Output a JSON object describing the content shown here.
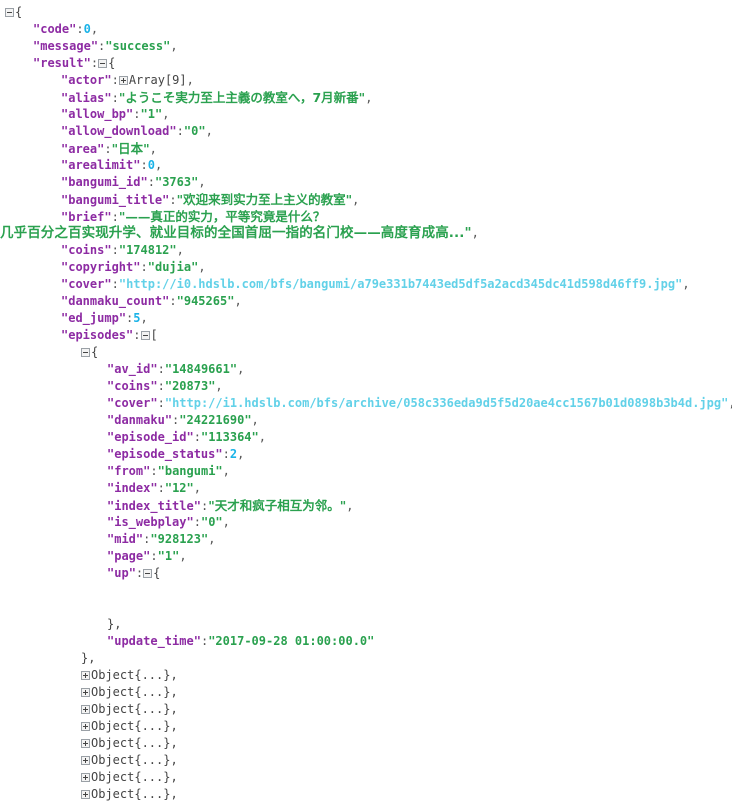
{
  "viewer": {
    "name": "json-tree-viewer",
    "colors": {
      "key": "#8d2ba3",
      "string": "#2aa14f",
      "number": "#1ab3e8",
      "url": "#62d1e8",
      "punctuation": "#555555",
      "background": "#ffffff"
    },
    "icons": {
      "collapse": "minus-box-icon",
      "expand": "plus-box-icon"
    }
  },
  "punct": {
    "colon": ":",
    "comma": ",",
    "quote": "\"",
    "open_brace": "{",
    "close_brace": "}",
    "close_brace_comma": "},",
    "open_bracket": "[",
    "close_bracket": "]"
  },
  "labels": {
    "array_9": "Array[9]",
    "object_collapsed": "Object{...},"
  },
  "root": {
    "keys": {
      "code": "code",
      "message": "message",
      "result": "result"
    },
    "values": {
      "code": "0",
      "message": "success"
    }
  },
  "result": {
    "keys": {
      "actor": "actor",
      "alias": "alias",
      "allow_bp": "allow_bp",
      "allow_download": "allow_download",
      "area": "area",
      "arealimit": "arealimit",
      "bangumi_id": "bangumi_id",
      "bangumi_title": "bangumi_title",
      "brief": "brief",
      "coins": "coins",
      "copyright": "copyright",
      "cover": "cover",
      "danmaku_count": "danmaku_count",
      "ed_jump": "ed_jump",
      "episodes": "episodes"
    },
    "values": {
      "actor": "Array[9]",
      "alias": "ようこそ実力至上主義の教室へ，7月新番",
      "allow_bp": "1",
      "allow_download": "0",
      "area": "日本",
      "arealimit": "0",
      "bangumi_id": "3763",
      "bangumi_title": "欢迎来到实力至上主义的教室",
      "brief_line1": "——真正的实力，平等究竟是什么？",
      "brief_line2": "几乎百分之百实现升学、就业目标的全国首屈一指的名门校——高度育成高...",
      "coins": "174812",
      "copyright": "dujia",
      "cover": "http://i0.hdslb.com/bfs/bangumi/a79e331b7443ed5df5a2acd345dc41d598d46ff9.jpg",
      "danmaku_count": "945265",
      "ed_jump": "5"
    }
  },
  "episode": {
    "keys": {
      "av_id": "av_id",
      "coins": "coins",
      "cover": "cover",
      "danmaku": "danmaku",
      "episode_id": "episode_id",
      "episode_status": "episode_status",
      "from": "from",
      "index": "index",
      "index_title": "index_title",
      "is_webplay": "is_webplay",
      "mid": "mid",
      "page": "page",
      "up": "up",
      "update_time": "update_time"
    },
    "values": {
      "av_id": "14849661",
      "coins": "20873",
      "cover": "http://i1.hdslb.com/bfs/archive/058c336eda9d5f5d20ae4cc1567b01d0898b3b4d.jpg",
      "danmaku": "24221690",
      "episode_id": "113364",
      "episode_status": "2",
      "from": "bangumi",
      "index": "12",
      "index_title": "天才和疯子相互为邻。",
      "is_webplay": "0",
      "mid": "928123",
      "page": "1",
      "update_time": "2017-09-28 01:00:00.0"
    }
  },
  "collapsed_objects": [
    "Object{...},",
    "Object{...},",
    "Object{...},",
    "Object{...},",
    "Object{...},",
    "Object{...},",
    "Object{...},",
    "Object{...},"
  ]
}
